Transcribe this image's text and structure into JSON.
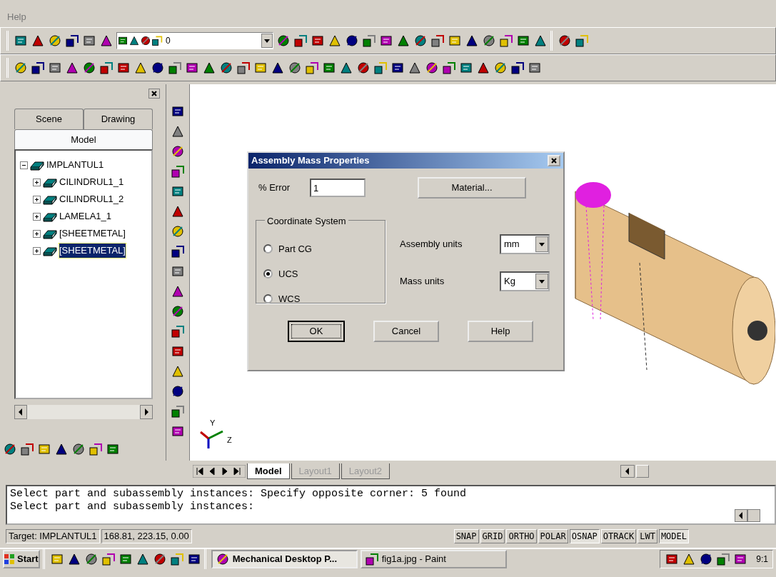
{
  "menu": [
    {
      "label": "Help"
    }
  ],
  "layer_combo": {
    "value": "0"
  },
  "panel": {
    "tabs": [
      {
        "label": "Scene",
        "selected": false
      },
      {
        "label": "Drawing",
        "selected": false
      },
      {
        "label": "Model",
        "selected": true
      }
    ],
    "tree": [
      {
        "label": "IMPLANTUL1",
        "expanded": true,
        "selected": false,
        "children": [
          {
            "label": "CILINDRUL1_1",
            "expanded": false,
            "selected": false
          },
          {
            "label": "CILINDRUL1_2",
            "expanded": false,
            "selected": false
          },
          {
            "label": "LAMELA1_1",
            "expanded": false,
            "selected": false
          },
          {
            "label": "[SHEETMETAL]",
            "expanded": false,
            "selected": false
          },
          {
            "label": "[SHEETMETAL]",
            "expanded": false,
            "selected": true
          }
        ]
      }
    ]
  },
  "dialog": {
    "title": "Assembly Mass Properties",
    "error_label": "% Error",
    "error_value": "1",
    "material_button": {
      "label": "Material..."
    },
    "group_title": "Coordinate System",
    "radios": [
      {
        "label": "Part CG",
        "selected": false
      },
      {
        "label": "UCS",
        "selected": true
      },
      {
        "label": "WCS",
        "selected": false
      }
    ],
    "selects": [
      {
        "label": "Assembly units",
        "value": "mm"
      },
      {
        "label": "Mass units",
        "value": "Kg"
      }
    ],
    "buttons": [
      {
        "label": "OK",
        "default": true
      },
      {
        "label": "Cancel",
        "default": false
      },
      {
        "label": "Help",
        "default": false
      }
    ]
  },
  "axis_labels": [
    "Y",
    "Z"
  ],
  "layout_tabs": [
    {
      "label": "Model",
      "selected": true
    },
    {
      "label": "Layout1",
      "selected": false
    },
    {
      "label": "Layout2",
      "selected": false
    }
  ],
  "command_lines": [
    "Select part and subassembly instances: Specify opposite corner: 5 found",
    "Select part and subassembly instances:"
  ],
  "status": {
    "target": "Target: IMPLANTUL1",
    "coords": "168.81, 223.15, 0.00",
    "toggles": [
      {
        "label": "SNAP",
        "on": false
      },
      {
        "label": "GRID",
        "on": false
      },
      {
        "label": "ORTHO",
        "on": false
      },
      {
        "label": "POLAR",
        "on": false
      },
      {
        "label": "OSNAP",
        "on": true
      },
      {
        "label": "OTRACK",
        "on": false
      },
      {
        "label": "LWT",
        "on": false
      },
      {
        "label": "MODEL",
        "on": true
      }
    ]
  },
  "taskbar": {
    "start": "Start",
    "tasks": [
      {
        "label": "Mechanical Desktop P...",
        "selected": true
      },
      {
        "label": "fig1a.jpg - Paint",
        "selected": false
      }
    ],
    "clock": "9:1"
  }
}
